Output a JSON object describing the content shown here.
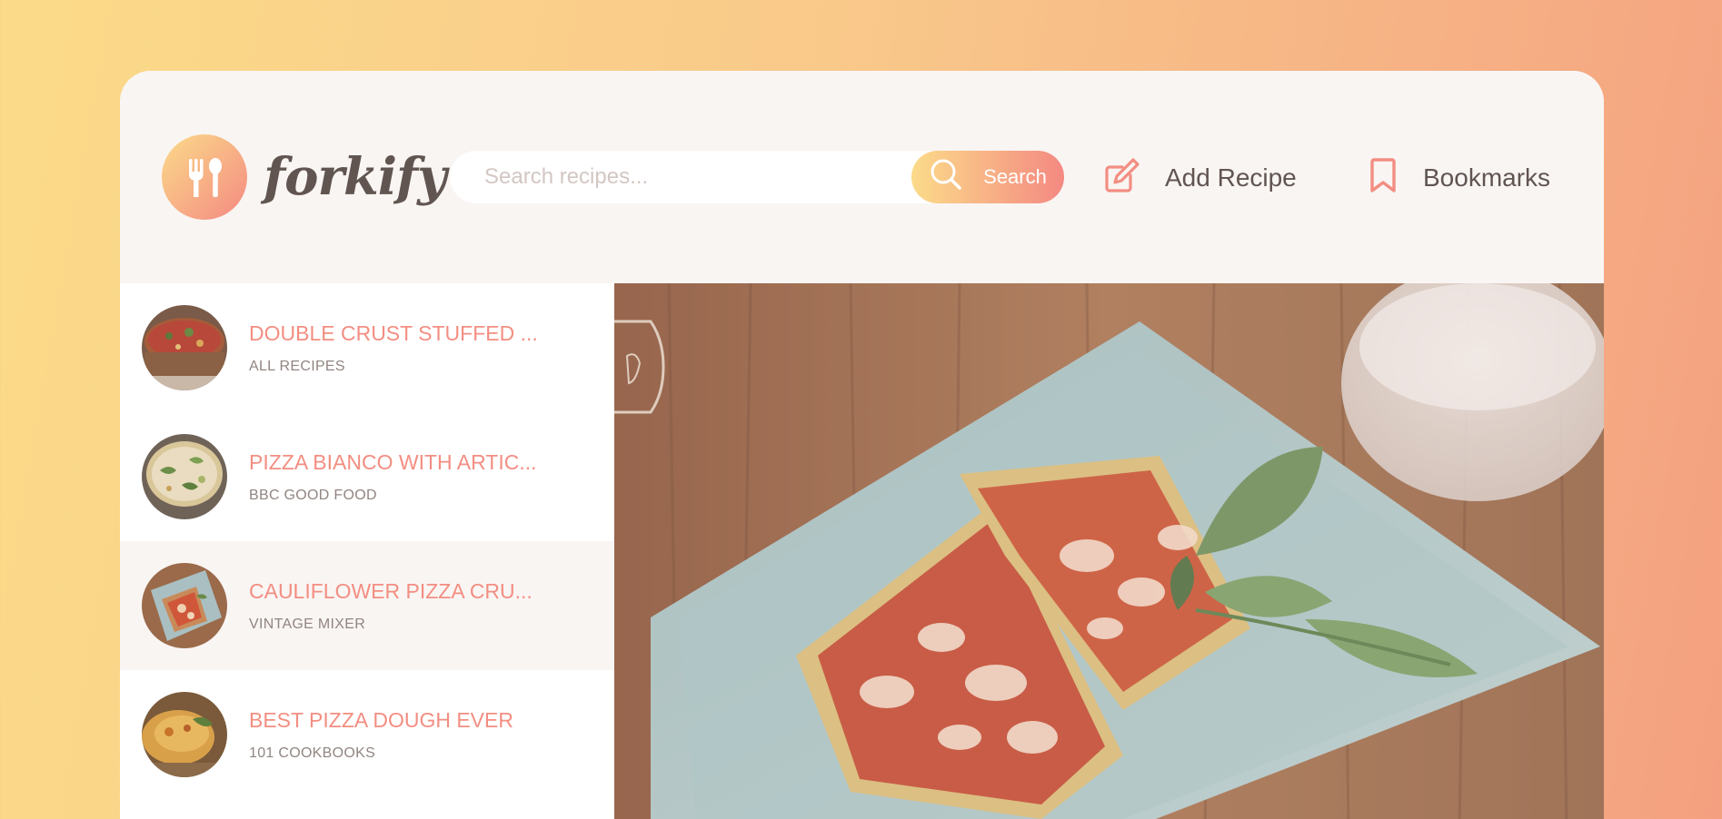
{
  "app": {
    "logo_text": "forkify"
  },
  "search": {
    "placeholder": "Search recipes...",
    "button_label": "Search"
  },
  "nav": {
    "add_recipe": "Add Recipe",
    "bookmarks": "Bookmarks"
  },
  "results": [
    {
      "title": "Double crust stuffed ...",
      "publisher": "All Recipes"
    },
    {
      "title": "Pizza bianco with artic...",
      "publisher": "BBC Good Food"
    },
    {
      "title": "Cauliflower pizza cru...",
      "publisher": "Vintage Mixer",
      "active": true
    },
    {
      "title": "Best pizza dough ever",
      "publisher": "101 Cookbooks"
    }
  ],
  "colors": {
    "accent": "#f38e82",
    "gradient_start": "#fbdb89",
    "gradient_end": "#f48982",
    "text_dark": "#615551",
    "background": "#f9f5f3"
  },
  "icons": {
    "logo": "fork-spoon-icon",
    "search": "search-icon",
    "add_recipe": "edit-icon",
    "bookmarks": "bookmark-icon"
  }
}
